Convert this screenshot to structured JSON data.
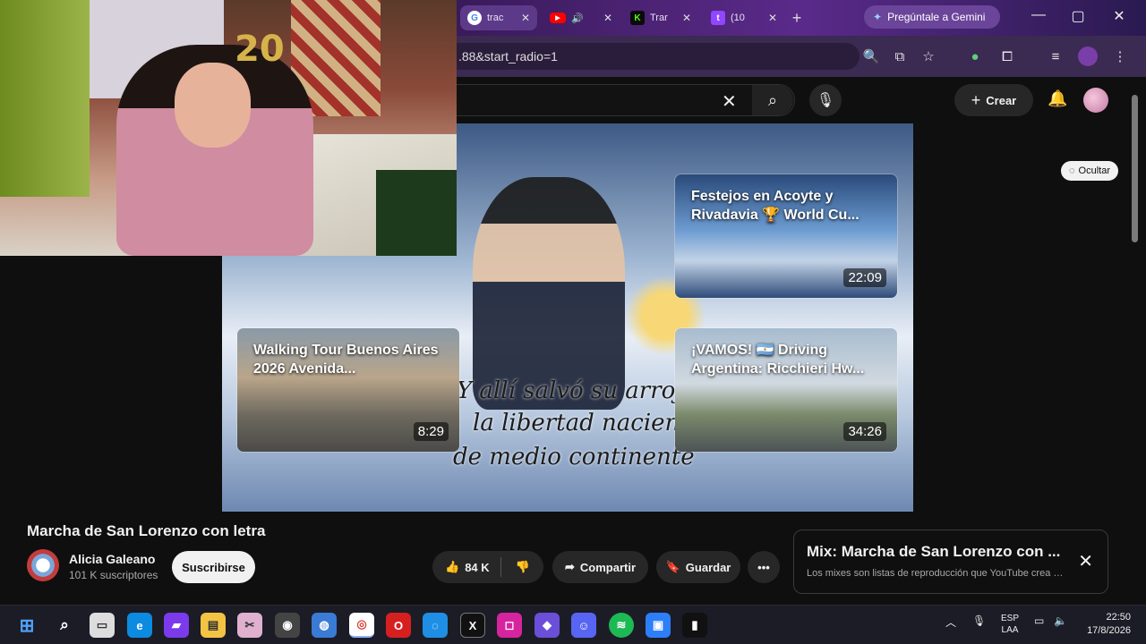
{
  "browser": {
    "tabs": [
      {
        "label": "trac",
        "icon": "google-icon",
        "color": "#4285f4"
      },
      {
        "label": "",
        "icon": "youtube-icon",
        "color": "#ff0000"
      },
      {
        "label": "Trar",
        "icon": "kick-icon",
        "color": "#53fc18"
      },
      {
        "label": "(10",
        "icon": "twitch-icon",
        "color": "#9146ff"
      }
    ],
    "gemini_label": "Pregúntale a Gemini",
    "url": ".88&start_radio=1"
  },
  "youtube": {
    "create_label": "Crear",
    "hide_label": "Ocultar",
    "lyrics": [
      "Y allí salvó su arrojo",
      "la libertad naciente",
      "de medio continente"
    ],
    "cards": [
      {
        "title": "Festejos en Acoyte y Rivadavia 🏆 World Cu...",
        "duration": "22:09"
      },
      {
        "title": "Walking Tour Buenos Aires 2026 Avenida...",
        "duration": "8:29"
      },
      {
        "title": "¡VAMOS! 🇦🇷 Driving Argentina: Ricchieri Hw...",
        "duration": "34:26"
      }
    ],
    "video_title": "Marcha de San Lorenzo con letra",
    "channel_name": "Alicia Galeano",
    "channel_subs": "101 K suscriptores",
    "subscribe_label": "Suscribirse",
    "likes": "84 K",
    "share_label": "Compartir",
    "save_label": "Guardar",
    "mix_title": "Mix: Marcha de San Lorenzo con ...",
    "mix_subtitle": "Los mixes son listas de reproducción que YouTube crea p..."
  },
  "taskbar": {
    "lang_top": "ESP",
    "lang_bottom": "LAA",
    "time": "22:50",
    "date": "17/8/2026"
  }
}
